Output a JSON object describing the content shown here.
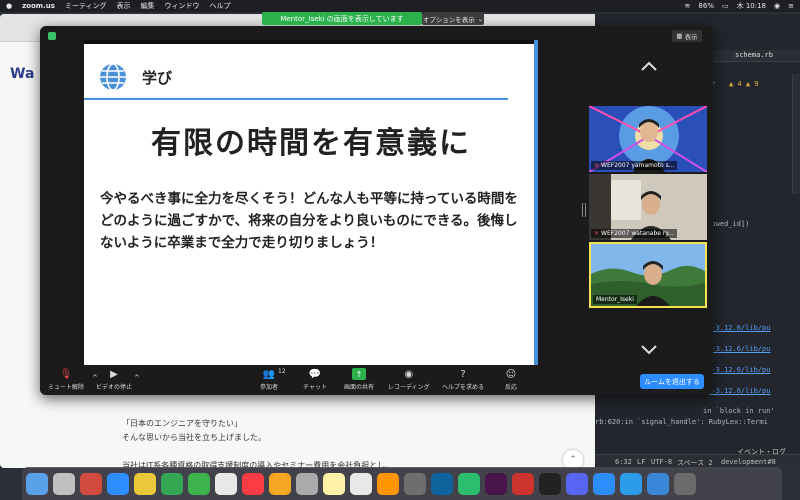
{
  "menubar": {
    "app": "zoom.us",
    "items": [
      "ミーティング",
      "表示",
      "編集",
      "ウィンドウ",
      "ヘルプ"
    ],
    "battery": "86%",
    "clock": "木 10:18"
  },
  "share_banner": {
    "text": "Mentor_Iseki の画面を表示しています",
    "options": "オプションを表示"
  },
  "view_button": "表示",
  "slide": {
    "section_title": "学び",
    "title": "有限の時間を有意義に",
    "body": "今やるべき事に全力を尽くそう！どんな人も平等に持っている時間をどのように過ごすかで、将来の自分をより良いものにできる。後悔しないように卒業まで全力で走り切りましょう！"
  },
  "participants": [
    {
      "name": "WEF2007 yamamoto s...",
      "muted": true
    },
    {
      "name": "WEF2007 watanabe ry...",
      "muted": true
    },
    {
      "name": "Mentor_Iseki",
      "muted": false
    }
  ],
  "toolbar": {
    "mute": "ミュート解除",
    "video": "ビデオの停止",
    "participants": "参加者",
    "participant_count": "12",
    "chat": "チャット",
    "share": "画面の共有",
    "record": "レコーディング",
    "help": "ヘルプを求める",
    "reactions": "反応",
    "end": "ルームを退出する"
  },
  "browser": {
    "logo": "Wa",
    "quote": "「日本のエンジニアを守りたい」",
    "line2": "そんな思いから当社を立ち上げました。",
    "line3": "当社はIT系各種資格の取得支援制度の導入やセミナー費用を会社負担とし、"
  },
  "editor": {
    "tab": "schema.rb",
    "partial_word": "ler",
    "warn": "▲ 4  ▲ 9",
    "code_id": "llowed_id])",
    "paths": [
      "na-3.12.6/lib/pu",
      "na-3.12.6/lib/pu",
      "na-3.12.6/lib/pu",
      "na-3.12.6/lib/pu"
    ],
    "line_block": "in `block in run'",
    "line_signal": "rb:620:in `signal_handle': RubyLex::Termi",
    "event_log": "イベント・ログ",
    "status_pos": "6:32",
    "status_lf": "LF",
    "status_enc": "UTF-8",
    "status_indent": "スペース 2",
    "status_branch": "development#8"
  },
  "dock_colors": [
    "#5aa0e8",
    "#c0c0c0",
    "#d24b3e",
    "#2d8cff",
    "#e9c83a",
    "#34a853",
    "#3cb44b",
    "#e8e8e8",
    "#fc3c44",
    "#f5a623",
    "#aaaaaa",
    "#fff2a8",
    "#e8e8e8",
    "#ff9500",
    "#6e6e6e",
    "#0e639c",
    "#2dbd6e",
    "#4a154b",
    "#cc342d",
    "#222222",
    "#5865f2",
    "#2d8cff",
    "#2d9ce8",
    "#3a86d9",
    "#6a6a6a"
  ],
  "colors": {
    "accent_blue": "#4a90d9",
    "zoom_blue": "#2d8cff",
    "share_green": "#2bb24c",
    "active_speaker": "#f3e156"
  }
}
